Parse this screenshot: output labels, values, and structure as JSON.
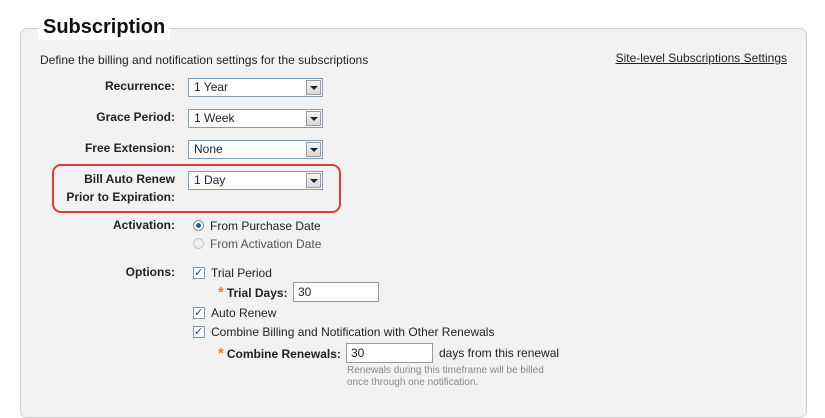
{
  "section": {
    "title": "Subscription",
    "description": "Define the billing and notification settings for the subscriptions",
    "site_link": "Site-level Subscriptions Settings"
  },
  "fields": {
    "recurrence": {
      "label": "Recurrence:",
      "value": "1 Year"
    },
    "grace_period": {
      "label": "Grace Period:",
      "value": "1 Week"
    },
    "free_extension": {
      "label": "Free Extension:",
      "value": "None"
    },
    "bill_auto_renew": {
      "label_line1": "Bill Auto Renew",
      "label_line2": "Prior to Expiration:",
      "value": "1 Day"
    }
  },
  "activation": {
    "label": "Activation:",
    "options": [
      {
        "label": "From Purchase Date",
        "selected": true
      },
      {
        "label": "From Activation Date",
        "selected": false
      }
    ]
  },
  "options": {
    "label": "Options:",
    "trial_period": {
      "label": "Trial Period",
      "checked": true
    },
    "trial_days": {
      "label": "Trial Days:",
      "value": "30"
    },
    "auto_renew": {
      "label": "Auto Renew",
      "checked": true
    },
    "combine_billing": {
      "label": "Combine Billing and Notification with Other Renewals",
      "checked": true
    },
    "combine_renewals": {
      "label": "Combine Renewals:",
      "value": "30",
      "suffix": "days from this renewal",
      "hint_line1": "Renewals during this timeframe will be billed",
      "hint_line2": "once through one notification."
    }
  },
  "required_marker": "*",
  "colors": {
    "highlight": "#e23a3a",
    "required": "#e08a1e",
    "panel": "#f2f2f2"
  }
}
